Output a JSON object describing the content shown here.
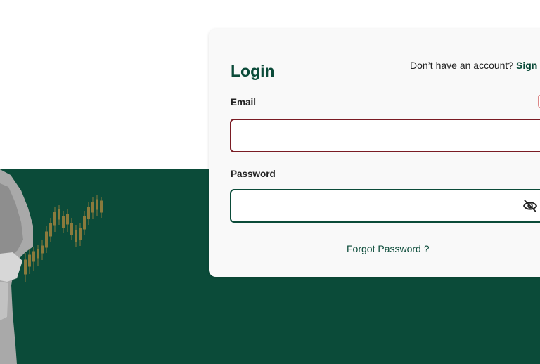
{
  "login": {
    "title": "Login",
    "signup_prompt": "Don’t have an account?",
    "signup_link": "Sign U",
    "email_label": "Email",
    "email_value": "",
    "password_label": "Password",
    "password_value": "",
    "forgot_password": "Forgot Password ?"
  },
  "icons": {
    "password_toggle": "eye-slash-icon",
    "error": "error-icon"
  },
  "colors": {
    "brand_green": "#0b4b39",
    "error_red": "#7a1c24",
    "candle_gold": "#8a7a3c",
    "card_bg": "#f9f9f9"
  }
}
